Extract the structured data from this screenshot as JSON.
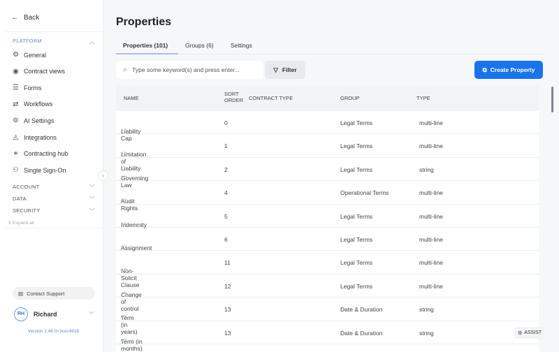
{
  "sidebar": {
    "back": "Back",
    "platform": "PLATFORM",
    "items": [
      {
        "label": "General",
        "icon": "gear-icon"
      },
      {
        "label": "Contract views",
        "icon": "eye-icon"
      },
      {
        "label": "Forms",
        "icon": "forms-icon"
      },
      {
        "label": "Workflows",
        "icon": "workflow-icon"
      },
      {
        "label": "AI Settings",
        "icon": "chip-icon"
      },
      {
        "label": "Integrations",
        "icon": "integrations-icon"
      },
      {
        "label": "Contracting hub",
        "icon": "hub-icon"
      },
      {
        "label": "Single Sign-On",
        "icon": "user-key-icon"
      }
    ],
    "account": "ACCOUNT",
    "data": "DATA",
    "security": "SECURITY",
    "expand_all": "Expand all",
    "contact_support": "Contact Support",
    "user_initials": "RH",
    "user_name": "Richard",
    "version": "Version 2.46.0+3cec4826"
  },
  "page": {
    "title": "Properties",
    "tabs": [
      "Properties (101)",
      "Groups (6)",
      "Settings"
    ],
    "search_placeholder": "Type some keyword(s) and press enter...",
    "filter": "Filter",
    "create": "Create Property",
    "assist": "ASSIST"
  },
  "table": {
    "headers": {
      "name": "NAME",
      "sort1": "SORT",
      "sort2": "ORDER",
      "contract_type": "CONTRACT TYPE",
      "group": "GROUP",
      "type": "TYPE"
    },
    "rows": [
      {
        "name": "Liability Cap",
        "sort": "0",
        "group": "Legal Terms",
        "type": "multi-line"
      },
      {
        "name": "Limitation of Liability",
        "sort": "1",
        "group": "Legal Terms",
        "type": "multi-line"
      },
      {
        "name": "Governing Law",
        "sort": "2",
        "group": "Legal Terms",
        "type": "string"
      },
      {
        "name": "Audit Rights",
        "sort": "4",
        "group": "Operational Terms",
        "type": "multi-line"
      },
      {
        "name": "Indemnity",
        "sort": "5",
        "group": "Legal Terms",
        "type": "multi-line"
      },
      {
        "name": "Assignment",
        "sort": "6",
        "group": "Legal Terms",
        "type": "multi-line"
      },
      {
        "name": "Non-Solicit Clause",
        "sort": "11",
        "group": "Legal Terms",
        "type": "multi-line"
      },
      {
        "name": "Change of control",
        "sort": "12",
        "group": "Legal Terms",
        "type": "multi-line"
      },
      {
        "name": "Term (in years)",
        "sort": "13",
        "group": "Date & Duration",
        "type": "string"
      },
      {
        "name": "Term (in months)",
        "sort": "13",
        "group": "Date & Duration",
        "type": "string"
      }
    ]
  }
}
